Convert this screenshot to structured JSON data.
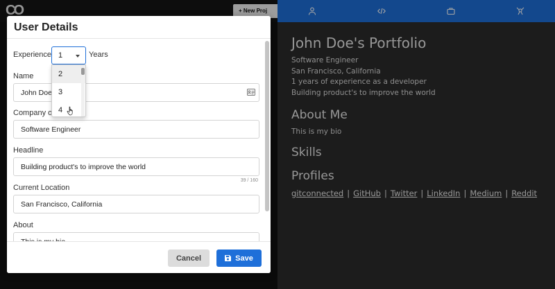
{
  "background": {
    "new_button_label": "+ New Proj"
  },
  "preview": {
    "nav_icons": [
      "person-icon",
      "code-icon",
      "briefcase-icon",
      "skills-icon"
    ],
    "name": "John Doe's Portfolio",
    "lines": [
      "Software Engineer",
      "San Francisco, California",
      "1 years of experience as a developer",
      "Building product's to improve the world"
    ],
    "about_heading": "About Me",
    "bio": "This is my bio",
    "skills_heading": "Skills",
    "profiles_heading": "Profiles",
    "profiles": [
      "gitconnected",
      "GitHub",
      "Twitter",
      "LinkedIn",
      "Medium",
      "Reddit"
    ]
  },
  "modal": {
    "title": "User Details",
    "experience": {
      "label": "Experience",
      "value": "1",
      "suffix": "Years",
      "options_visible": [
        "2",
        "3",
        "4"
      ],
      "hovered_option": "2"
    },
    "name": {
      "label": "Name",
      "value": "John Doe"
    },
    "company": {
      "label": "Company or",
      "value": "Software Engineer"
    },
    "headline": {
      "label": "Headline",
      "value": "Building product's to improve the world",
      "counter": "39 / 160"
    },
    "location": {
      "label": "Current Location",
      "value": "San Francisco, California"
    },
    "about": {
      "label": "About",
      "value": "This is my bio"
    },
    "cancel_label": "Cancel",
    "save_label": "Save"
  },
  "colors": {
    "accent": "#1e6fd9",
    "preview_bg": "#2b2b2b"
  }
}
